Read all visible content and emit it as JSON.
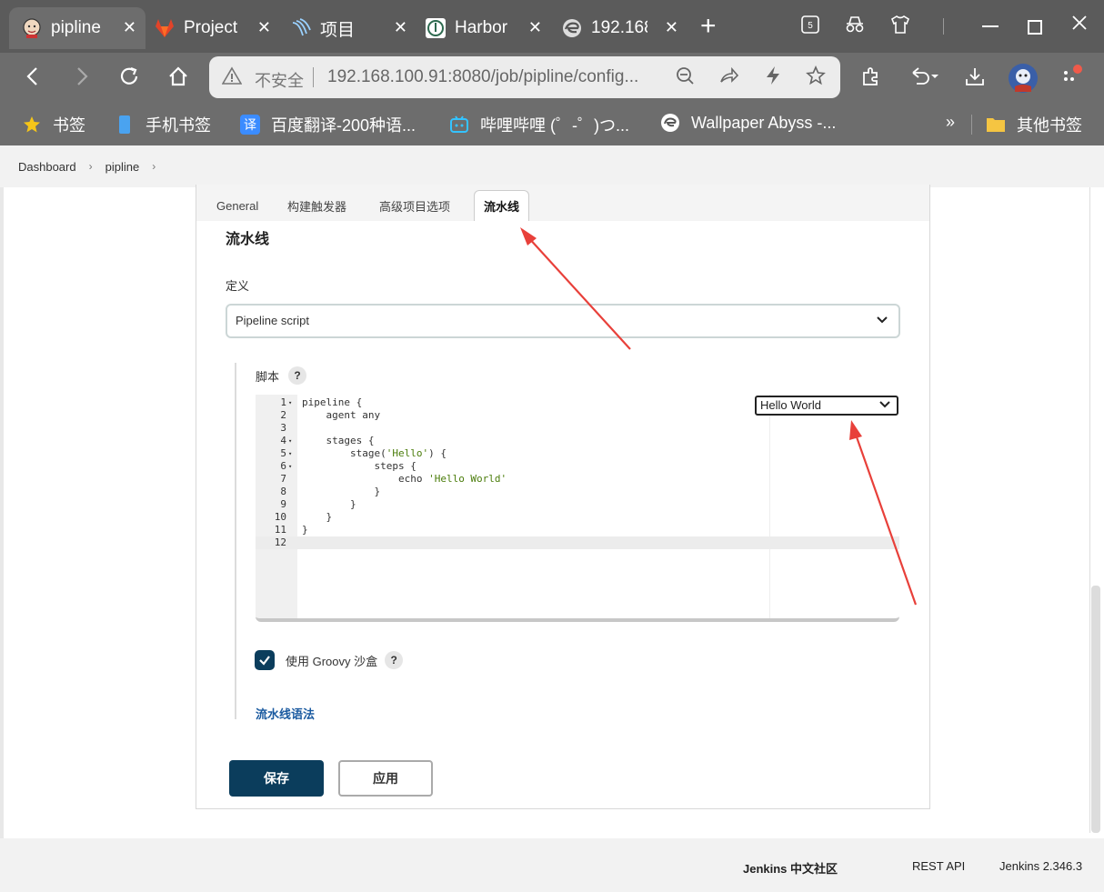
{
  "browser": {
    "tabs": [
      {
        "title": "pipline",
        "close": "✕"
      },
      {
        "title": "Project",
        "close": "✕"
      },
      {
        "title": "项目",
        "close": "✕"
      },
      {
        "title": "Harbor",
        "close": "✕"
      },
      {
        "title": "192.168",
        "close": "✕"
      }
    ],
    "new_tab": "+",
    "address": {
      "security": "不安全",
      "url": "192.168.100.91:8080/job/pipline/config..."
    },
    "bookmarks": [
      "书签",
      "手机书签",
      "百度翻译-200种语...",
      "哔哩哔哩 (゜-゜)つ...",
      "Wallpaper Abyss -...",
      "其他书签"
    ],
    "bookmarks_more": "»",
    "tab_counter": "5"
  },
  "breadcrumb": [
    "Dashboard",
    "pipline"
  ],
  "config": {
    "tabs": [
      "General",
      "构建触发器",
      "高级项目选项",
      "流水线"
    ],
    "section_title": "流水线",
    "definition_label": "定义",
    "definition_value": "Pipeline script",
    "script_label": "脚本",
    "help": "?",
    "sample_select": "Hello World",
    "script_lines": [
      {
        "n": "1",
        "fold": true,
        "code": "pipeline {"
      },
      {
        "n": "2",
        "fold": false,
        "code": "    agent any"
      },
      {
        "n": "3",
        "fold": false,
        "code": ""
      },
      {
        "n": "4",
        "fold": true,
        "code": "    stages {"
      },
      {
        "n": "5",
        "fold": true,
        "code": "        stage('Hello') {"
      },
      {
        "n": "6",
        "fold": true,
        "code": "            steps {"
      },
      {
        "n": "7",
        "fold": false,
        "code": "                echo 'Hello World'"
      },
      {
        "n": "8",
        "fold": false,
        "code": "            }"
      },
      {
        "n": "9",
        "fold": false,
        "code": "        }"
      },
      {
        "n": "10",
        "fold": false,
        "code": "    }"
      },
      {
        "n": "11",
        "fold": false,
        "code": "}"
      },
      {
        "n": "12",
        "fold": false,
        "code": ""
      }
    ],
    "sandbox_label": "使用 Groovy 沙盒",
    "sandbox_checked": true,
    "syntax_link": "流水线语法",
    "save": "保存",
    "apply": "应用"
  },
  "footer": {
    "community": "Jenkins 中文社区",
    "rest_api": "REST API",
    "version": "Jenkins 2.346.3"
  },
  "colors": {
    "primary": "#0b3d5c",
    "arrow": "#e8403a",
    "link": "#1a5aa0",
    "string": "#4a7c0a"
  }
}
